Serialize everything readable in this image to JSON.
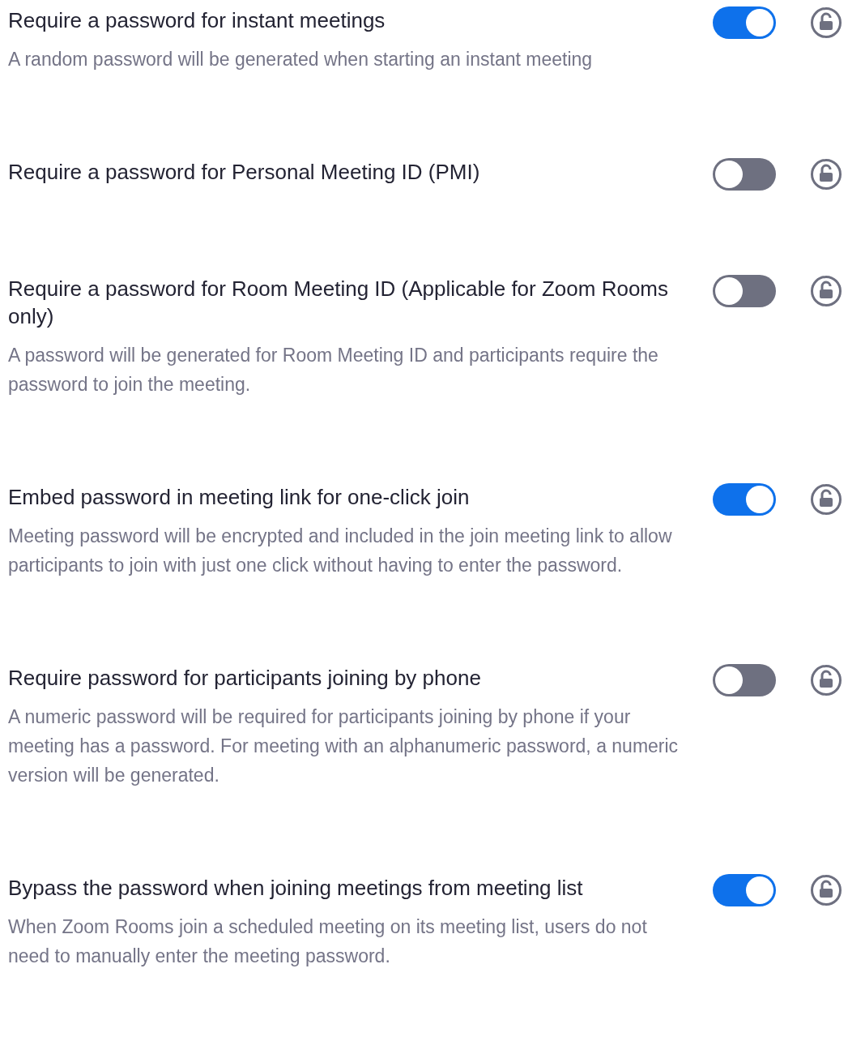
{
  "settings": [
    {
      "title": "Require a password for instant meetings",
      "description": "A random password will be generated when starting an instant meeting",
      "on": true
    },
    {
      "title": "Require a password for Personal Meeting ID (PMI)",
      "on": false
    },
    {
      "title": "Require a password for Room Meeting ID (Applicable for Zoom Rooms only)",
      "description": "A password will be generated for Room Meeting ID and participants require the password to join the meeting.",
      "on": false
    },
    {
      "title": "Embed password in meeting link for one-click join",
      "description": "Meeting password will be encrypted and included in the join meeting link to allow participants to join with just one click without having to enter the password.",
      "on": true
    },
    {
      "title": "Require password for participants joining by phone",
      "description": "A numeric password will be required for participants joining by phone if your meeting has a password. For meeting with an alphanumeric password, a numeric version will be generated.",
      "on": false
    },
    {
      "title": "Bypass the password when joining meetings from meeting list",
      "description": "When Zoom Rooms join a scheduled meeting on its meeting list, users do not need to manually enter the meeting password.",
      "on": true
    }
  ]
}
